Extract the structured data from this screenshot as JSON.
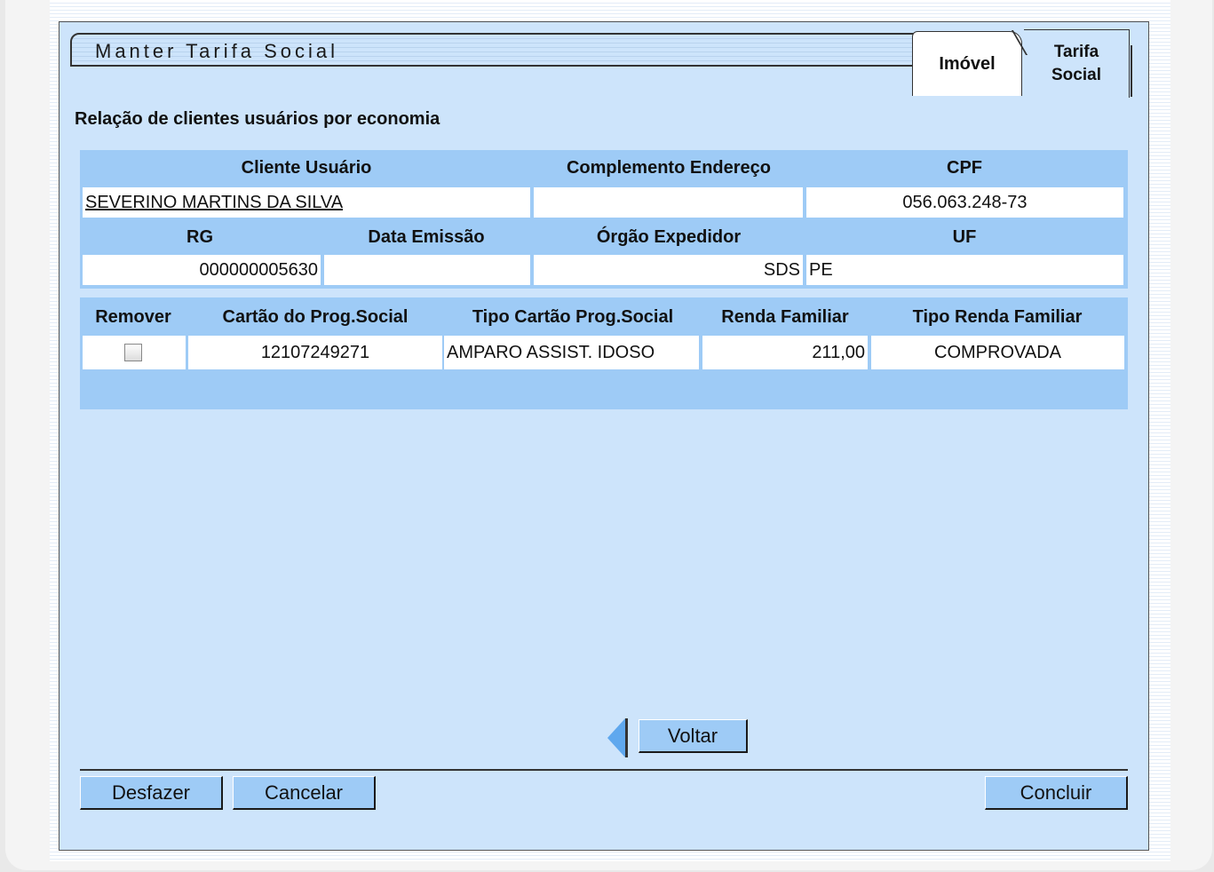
{
  "window": {
    "title": "Manter Tarifa Social"
  },
  "tabs": [
    {
      "label": "Imóvel"
    },
    {
      "label": "Tarifa Social"
    }
  ],
  "section": {
    "title": "Relação de clientes usuários por economia"
  },
  "client_table": {
    "headers": {
      "cliente": "Cliente Usuário",
      "complemento": "Complemento Endereço",
      "cpf": "CPF",
      "rg": "RG",
      "data_emissao": "Data Emissão",
      "orgao": "Órgão Expedidor",
      "uf": "UF"
    },
    "row": {
      "cliente": "SEVERINO MARTINS DA SILVA",
      "complemento": "",
      "cpf": "056.063.248-73",
      "rg": "000000005630",
      "data_emissao": "",
      "orgao": "SDS",
      "uf": "PE"
    }
  },
  "program_table": {
    "headers": {
      "remover": "Remover",
      "cartao": "Cartão do Prog.Social",
      "tipo_cartao": "Tipo Cartão Prog.Social",
      "renda": "Renda Familiar",
      "tipo_renda": "Tipo Renda Familiar"
    },
    "row": {
      "remover": false,
      "cartao": "12107249271",
      "tipo_cartao": "AMPARO ASSIST. IDOSO",
      "renda": "211,00",
      "tipo_renda": "COMPROVADA"
    }
  },
  "buttons": {
    "voltar": "Voltar",
    "desfazer": "Desfazer",
    "cancelar": "Cancelar",
    "concluir": "Concluir"
  }
}
